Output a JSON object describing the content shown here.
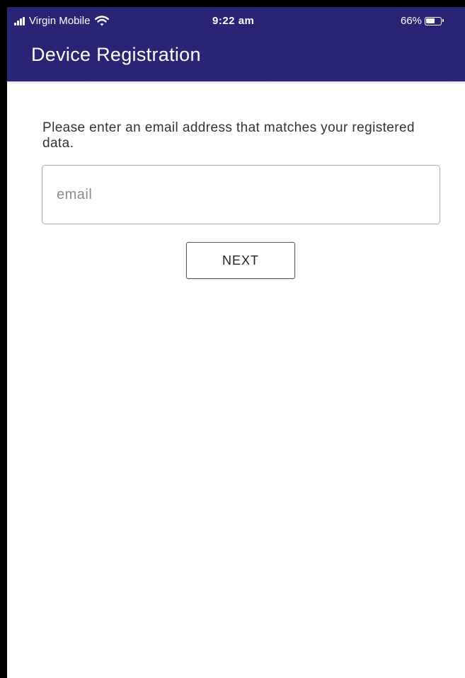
{
  "status_bar": {
    "carrier": "Virgin Mobile",
    "time": "9:22 am",
    "battery_percent": "66%",
    "battery_level": 0.66,
    "icons": [
      "signal-icon",
      "wifi-icon",
      "battery-icon"
    ]
  },
  "header": {
    "title": "Device Registration",
    "background_color": "#2a2474"
  },
  "form": {
    "prompt": "Please enter an email address that matches your registered data.",
    "email_placeholder": "email",
    "email_value": "",
    "next_label": "NEXT"
  }
}
